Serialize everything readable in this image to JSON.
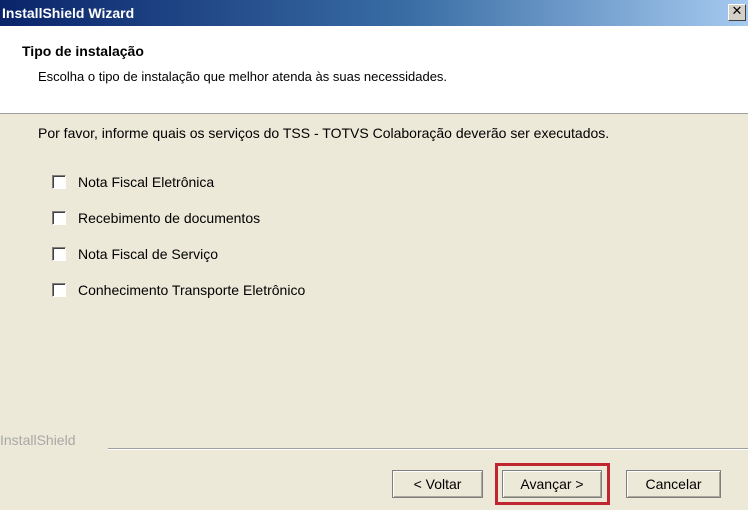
{
  "window": {
    "title": "InstallShield Wizard",
    "close_glyph": "✕"
  },
  "header": {
    "title": "Tipo de instalação",
    "description": "Escolha o tipo de instalação que melhor atenda às suas necessidades."
  },
  "instruction": "Por favor, informe quais os serviços do TSS - TOTVS Colaboração deverão ser executados.",
  "options": [
    {
      "label": "Nota Fiscal Eletrônica",
      "checked": false
    },
    {
      "label": "Recebimento de documentos",
      "checked": false
    },
    {
      "label": "Nota Fiscal de Serviço",
      "checked": false
    },
    {
      "label": "Conhecimento Transporte Eletrônico",
      "checked": false
    }
  ],
  "brand": "InstallShield",
  "buttons": {
    "back": "< Voltar",
    "next": "Avançar >",
    "cancel": "Cancelar"
  },
  "colors": {
    "highlight": "#c0262f",
    "titlebar": "#0a246a",
    "dialog_bg": "#ece9d8"
  }
}
